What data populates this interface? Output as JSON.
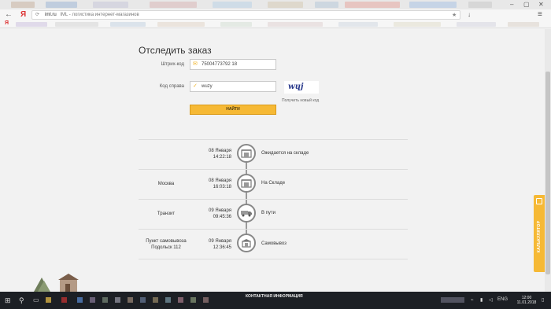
{
  "browser": {
    "url_host": "iml.ru",
    "page_title": "IML - логистика интернет-магазинов",
    "back_glyph": "←",
    "refresh_glyph": "⟳",
    "yandex_glyph": "Я",
    "minimize_glyph": "–",
    "maximize_glyph": "▢",
    "close_glyph": "✕",
    "star_glyph": "★",
    "download_glyph": "↓",
    "menu_glyph": "≡"
  },
  "track": {
    "title": "Отследить заказ",
    "barcode_label": "Штрих-код",
    "barcode_value": "75004773792 18",
    "captcha_label": "Код справа",
    "captcha_value": "wuzy",
    "captcha_image_text": "wɥj",
    "refresh_captcha": "Получить новый код",
    "find_button": "НАЙТИ"
  },
  "events": [
    {
      "city": "",
      "date": "08 Января",
      "time": "14:22:18",
      "status": "Ожидается на складе",
      "icon": "warehouse-icon"
    },
    {
      "city": "Москва",
      "date": "08 Января",
      "time": "16:03:18",
      "status": "На Складе",
      "icon": "warehouse-icon"
    },
    {
      "city": "Транзит",
      "date": "09 Января",
      "time": "09:45:36",
      "status": "В пути",
      "icon": "truck-icon"
    },
    {
      "city": "Пункт самовывоза Подольск 112",
      "date": "09 Января",
      "time": "12:36:45",
      "status": "Самовывоз",
      "icon": "pickup-point-icon"
    }
  ],
  "sidebar_tab": {
    "label": "КАЛЬКУЛЯТОР",
    "icon": "calculator-icon"
  },
  "footer": {
    "contact_label": "КОНТАКТНАЯ ИНФОРМАЦИЯ"
  },
  "taskbar": {
    "start_glyph": "⊞",
    "search_glyph": "⚲",
    "language": "ENG",
    "time": "12:00",
    "date": "11.01.2018"
  },
  "colors": {
    "accent": "#f6b935",
    "timeline": "#9a9a9a"
  }
}
